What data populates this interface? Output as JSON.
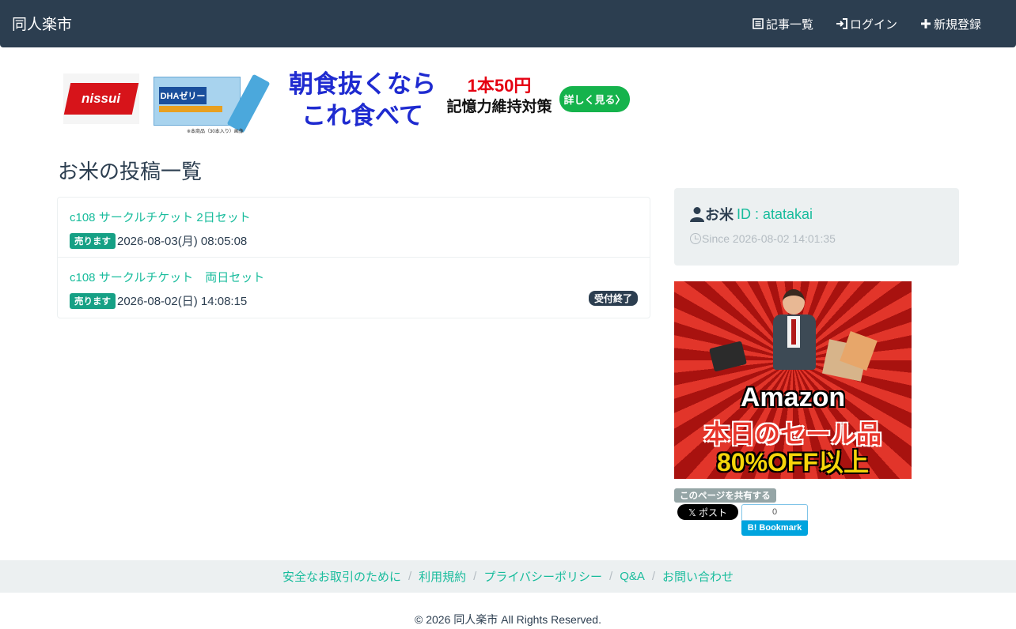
{
  "navbar": {
    "brand": "同人楽市",
    "links": [
      {
        "label": "記事一覧",
        "icon": "list-icon"
      },
      {
        "label": "ログイン",
        "icon": "login-icon"
      },
      {
        "label": "新規登録",
        "icon": "plus-icon"
      }
    ]
  },
  "ad_banner": {
    "logo_text": "nissui",
    "product_label": "DHAゼリー",
    "product_note": "※本商品（30本入り）画像",
    "headline_1": "朝食抜くなら",
    "headline_2": "これ食べて",
    "price": "1本50円",
    "subline": "記憶力維持対策",
    "cta": "詳しく見る〉"
  },
  "page_title": "お米の投稿一覧",
  "posts": [
    {
      "title": "c108 サークルチケット 2日セット",
      "badge": "売ります",
      "date": "2026-08-03(月) 08:05:08",
      "status": ""
    },
    {
      "title": "c108 サークルチケット　両日セット",
      "badge": "売ります",
      "date": "2026-08-02(日) 14:08:15",
      "status": "受付終了"
    }
  ],
  "profile": {
    "name": "お米",
    "id": "ID : atatakai",
    "since": "Since 2026-08-02 14:01:35"
  },
  "promo": {
    "line1": "Amazon",
    "line2": "本日のセール品",
    "line3": "80%OFF以上"
  },
  "share": {
    "label": "このページを共有する",
    "x_post": "𝕏 ポスト",
    "hatena_count": "0",
    "hatena_label": "B! Bookmark"
  },
  "footer": {
    "links": [
      "安全なお取引のために",
      "利用規約",
      "プライバシーポリシー",
      "Q&A",
      "お問い合わせ"
    ],
    "copyright": "© 2026 同人楽市 All Rights Reserved."
  },
  "colors": {
    "navbar": "#2c3e50",
    "accent": "#18bc9c",
    "badge_sell": "#16a085",
    "panel_bg": "#ecf0f1"
  }
}
